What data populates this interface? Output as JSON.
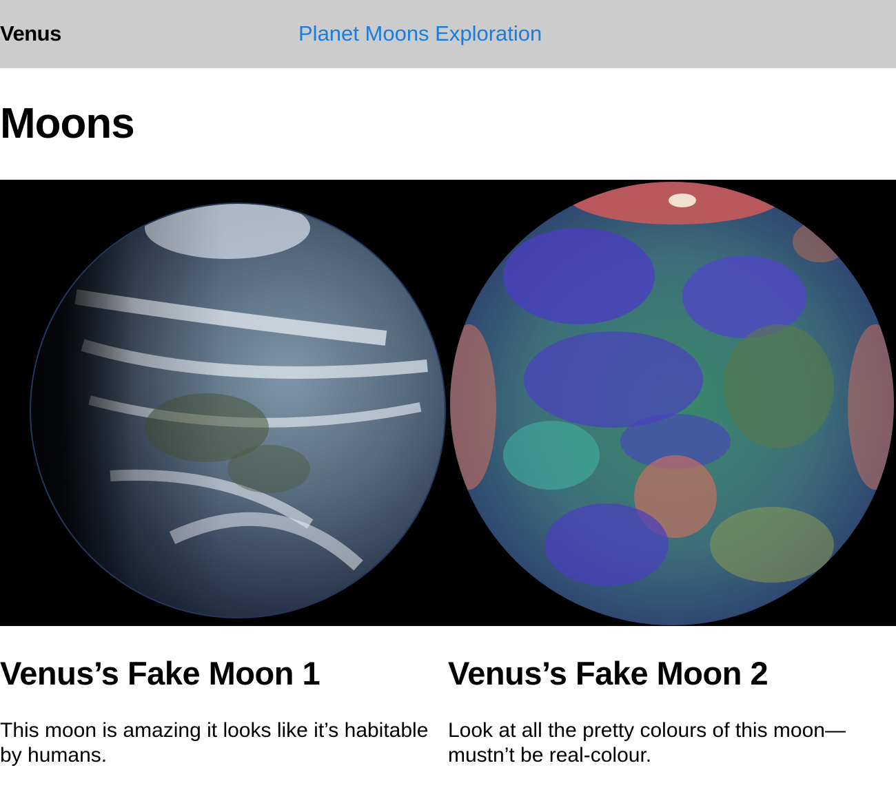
{
  "header": {
    "site_name": "Venus",
    "nav_link": "Planet Moons Exploration"
  },
  "page_title": "Moons",
  "moons": [
    {
      "title": "Venus’s Fake Moon 1",
      "description": "This moon is amazing it looks like it’s habitable by humans."
    },
    {
      "title": "Venus’s Fake Moon 2",
      "description": "Look at all the pretty colours of this moon—mustn’t be real-colour."
    }
  ],
  "colors": {
    "header_bg": "#cccccc",
    "link": "#1a7be0"
  }
}
